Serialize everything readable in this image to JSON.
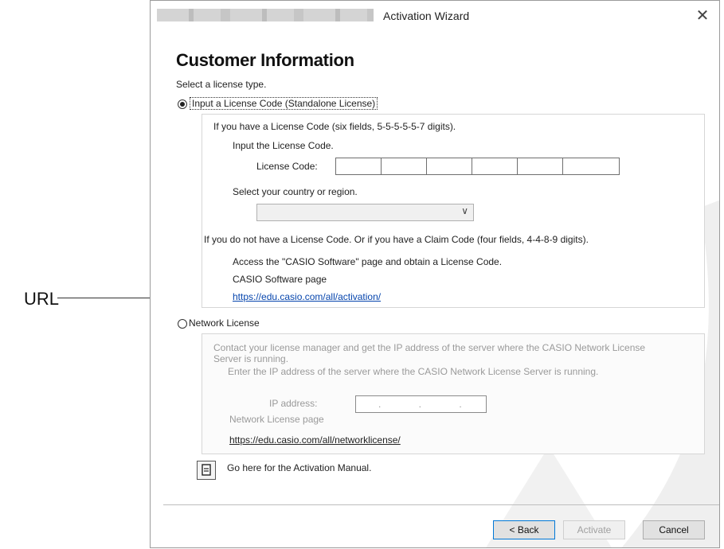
{
  "callout": {
    "label": "URL"
  },
  "window": {
    "title": "Activation Wizard",
    "heading": "Customer Information",
    "prompt": "Select a license type."
  },
  "standalone": {
    "option_label": "Input a License Code (Standalone License)",
    "selected": true,
    "have_code_text": "If you have a License Code (six fields, 5-5-5-5-5-7 digits).",
    "input_instruction": "Input the License Code.",
    "code_label": "License Code:",
    "code_fields": [
      "",
      "",
      "",
      "",
      "",
      ""
    ],
    "country_instruction": "Select your country or region.",
    "country_value": "",
    "no_code_text": "If you do not have a License Code. Or if you have a Claim Code (four fields, 4-4-8-9 digits).",
    "access_text": "Access the \"CASIO Software\" page and obtain a License Code.",
    "page_label": "CASIO Software page",
    "page_link": "https://edu.casio.com/all/activation/"
  },
  "network": {
    "option_label": "Network License",
    "selected": false,
    "contact_text_1": "Contact your license manager and get the IP address of the server where the CASIO Network License",
    "contact_text_2": "Server is running.",
    "enter_ip_text": "Enter the IP address of the server where the CASIO Network License Server is running.",
    "ip_label": "IP address:",
    "ip_value": ". . .",
    "page_label": "Network License page",
    "page_link": "https://edu.casio.com/all/networklicense/"
  },
  "manual": {
    "text": "Go here for the Activation Manual.",
    "icon": "document-icon"
  },
  "buttons": {
    "back": "< Back",
    "activate": "Activate",
    "cancel": "Cancel"
  },
  "colors": {
    "link": "#0645ad",
    "accent": "#0078d7",
    "disabled_text": "#a0a0a0"
  }
}
